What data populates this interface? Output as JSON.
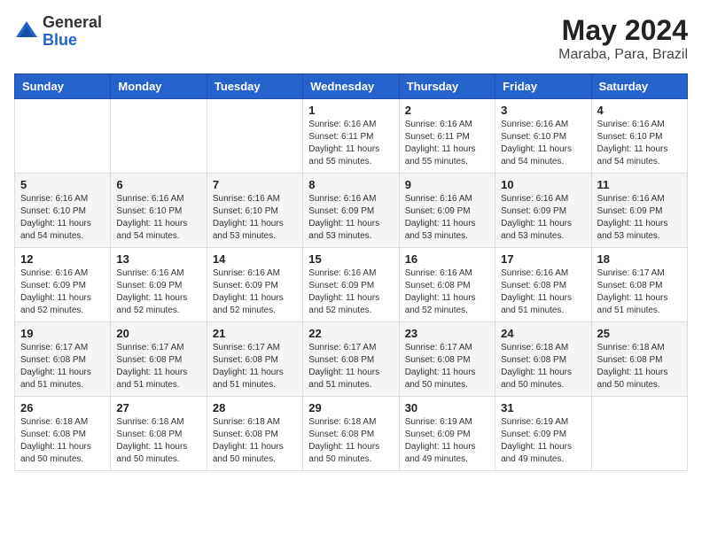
{
  "logo": {
    "general": "General",
    "blue": "Blue"
  },
  "title": {
    "month_year": "May 2024",
    "location": "Maraba, Para, Brazil"
  },
  "weekdays": [
    "Sunday",
    "Monday",
    "Tuesday",
    "Wednesday",
    "Thursday",
    "Friday",
    "Saturday"
  ],
  "weeks": [
    [
      {
        "day": "",
        "info": ""
      },
      {
        "day": "",
        "info": ""
      },
      {
        "day": "",
        "info": ""
      },
      {
        "day": "1",
        "info": "Sunrise: 6:16 AM\nSunset: 6:11 PM\nDaylight: 11 hours\nand 55 minutes."
      },
      {
        "day": "2",
        "info": "Sunrise: 6:16 AM\nSunset: 6:11 PM\nDaylight: 11 hours\nand 55 minutes."
      },
      {
        "day": "3",
        "info": "Sunrise: 6:16 AM\nSunset: 6:10 PM\nDaylight: 11 hours\nand 54 minutes."
      },
      {
        "day": "4",
        "info": "Sunrise: 6:16 AM\nSunset: 6:10 PM\nDaylight: 11 hours\nand 54 minutes."
      }
    ],
    [
      {
        "day": "5",
        "info": "Sunrise: 6:16 AM\nSunset: 6:10 PM\nDaylight: 11 hours\nand 54 minutes."
      },
      {
        "day": "6",
        "info": "Sunrise: 6:16 AM\nSunset: 6:10 PM\nDaylight: 11 hours\nand 54 minutes."
      },
      {
        "day": "7",
        "info": "Sunrise: 6:16 AM\nSunset: 6:10 PM\nDaylight: 11 hours\nand 53 minutes."
      },
      {
        "day": "8",
        "info": "Sunrise: 6:16 AM\nSunset: 6:09 PM\nDaylight: 11 hours\nand 53 minutes."
      },
      {
        "day": "9",
        "info": "Sunrise: 6:16 AM\nSunset: 6:09 PM\nDaylight: 11 hours\nand 53 minutes."
      },
      {
        "day": "10",
        "info": "Sunrise: 6:16 AM\nSunset: 6:09 PM\nDaylight: 11 hours\nand 53 minutes."
      },
      {
        "day": "11",
        "info": "Sunrise: 6:16 AM\nSunset: 6:09 PM\nDaylight: 11 hours\nand 53 minutes."
      }
    ],
    [
      {
        "day": "12",
        "info": "Sunrise: 6:16 AM\nSunset: 6:09 PM\nDaylight: 11 hours\nand 52 minutes."
      },
      {
        "day": "13",
        "info": "Sunrise: 6:16 AM\nSunset: 6:09 PM\nDaylight: 11 hours\nand 52 minutes."
      },
      {
        "day": "14",
        "info": "Sunrise: 6:16 AM\nSunset: 6:09 PM\nDaylight: 11 hours\nand 52 minutes."
      },
      {
        "day": "15",
        "info": "Sunrise: 6:16 AM\nSunset: 6:09 PM\nDaylight: 11 hours\nand 52 minutes."
      },
      {
        "day": "16",
        "info": "Sunrise: 6:16 AM\nSunset: 6:08 PM\nDaylight: 11 hours\nand 52 minutes."
      },
      {
        "day": "17",
        "info": "Sunrise: 6:16 AM\nSunset: 6:08 PM\nDaylight: 11 hours\nand 51 minutes."
      },
      {
        "day": "18",
        "info": "Sunrise: 6:17 AM\nSunset: 6:08 PM\nDaylight: 11 hours\nand 51 minutes."
      }
    ],
    [
      {
        "day": "19",
        "info": "Sunrise: 6:17 AM\nSunset: 6:08 PM\nDaylight: 11 hours\nand 51 minutes."
      },
      {
        "day": "20",
        "info": "Sunrise: 6:17 AM\nSunset: 6:08 PM\nDaylight: 11 hours\nand 51 minutes."
      },
      {
        "day": "21",
        "info": "Sunrise: 6:17 AM\nSunset: 6:08 PM\nDaylight: 11 hours\nand 51 minutes."
      },
      {
        "day": "22",
        "info": "Sunrise: 6:17 AM\nSunset: 6:08 PM\nDaylight: 11 hours\nand 51 minutes."
      },
      {
        "day": "23",
        "info": "Sunrise: 6:17 AM\nSunset: 6:08 PM\nDaylight: 11 hours\nand 50 minutes."
      },
      {
        "day": "24",
        "info": "Sunrise: 6:18 AM\nSunset: 6:08 PM\nDaylight: 11 hours\nand 50 minutes."
      },
      {
        "day": "25",
        "info": "Sunrise: 6:18 AM\nSunset: 6:08 PM\nDaylight: 11 hours\nand 50 minutes."
      }
    ],
    [
      {
        "day": "26",
        "info": "Sunrise: 6:18 AM\nSunset: 6:08 PM\nDaylight: 11 hours\nand 50 minutes."
      },
      {
        "day": "27",
        "info": "Sunrise: 6:18 AM\nSunset: 6:08 PM\nDaylight: 11 hours\nand 50 minutes."
      },
      {
        "day": "28",
        "info": "Sunrise: 6:18 AM\nSunset: 6:08 PM\nDaylight: 11 hours\nand 50 minutes."
      },
      {
        "day": "29",
        "info": "Sunrise: 6:18 AM\nSunset: 6:08 PM\nDaylight: 11 hours\nand 50 minutes."
      },
      {
        "day": "30",
        "info": "Sunrise: 6:19 AM\nSunset: 6:09 PM\nDaylight: 11 hours\nand 49 minutes."
      },
      {
        "day": "31",
        "info": "Sunrise: 6:19 AM\nSunset: 6:09 PM\nDaylight: 11 hours\nand 49 minutes."
      },
      {
        "day": "",
        "info": ""
      }
    ]
  ]
}
